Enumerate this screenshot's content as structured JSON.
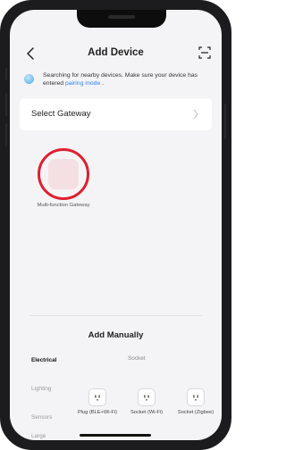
{
  "header": {
    "title": "Add Device"
  },
  "search": {
    "text": "Searching for nearby devices. Make sure your device has entered ",
    "link": "pairing mode",
    "link_suffix": " ."
  },
  "gateway": {
    "label": "Select Gateway"
  },
  "discovered": {
    "label": "Multi-function Gateway"
  },
  "manual": {
    "title": "Add Manually",
    "subcategory": "Socket",
    "categories": [
      {
        "label": "Electrical",
        "active": true
      },
      {
        "label": "Lighting",
        "active": false
      },
      {
        "label": "Sensors",
        "active": false
      },
      {
        "label": "Large",
        "active": false
      }
    ],
    "products": [
      {
        "label": "Plug (BLE+Wi-Fi)",
        "icon": "plug-icon"
      },
      {
        "label": "Socket (Wi-Fi)",
        "icon": "socket-icon"
      },
      {
        "label": "Socket (Zigbee)",
        "icon": "socket-icon"
      }
    ]
  },
  "colors": {
    "accent_link": "#2f80ed",
    "highlight_ring": "#e01f2f",
    "device_tint": "#f4dfe2",
    "background": "#f4f4f6"
  }
}
